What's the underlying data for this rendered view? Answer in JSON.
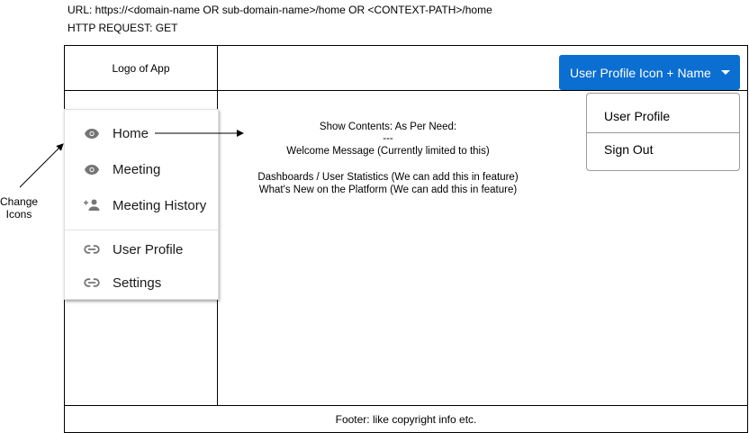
{
  "header_meta": {
    "url": "URL: https://<domain-name OR sub-domain-name>/home OR <CONTEXT-PATH>/home",
    "request": "HTTP REQUEST: GET"
  },
  "app": {
    "logo_text": "Logo of App",
    "user_button_label": "User Profile Icon + Name",
    "user_menu": [
      "User Profile",
      "Sign Out"
    ],
    "accent_color": "#0b6ed1"
  },
  "sidebar": {
    "items": [
      {
        "label": "Home",
        "icon": "eye-icon"
      },
      {
        "label": "Meeting",
        "icon": "eye-icon"
      },
      {
        "label": "Meeting History",
        "icon": "add-person-icon"
      },
      {
        "label": "User Profile",
        "icon": "link-icon"
      },
      {
        "label": "Settings",
        "icon": "link-icon"
      }
    ]
  },
  "content": {
    "lines": [
      "Show Contents: As Per Need:",
      "---",
      "Welcome Message (Currently limited to this)",
      "",
      "Dashboards / User Statistics (We can add this in feature)",
      "What's New on the Platform (We can add this in feature)"
    ]
  },
  "annotation": {
    "line1": "Change",
    "line2": "Icons"
  },
  "footer": {
    "text": "Footer: like copyright info etc."
  }
}
